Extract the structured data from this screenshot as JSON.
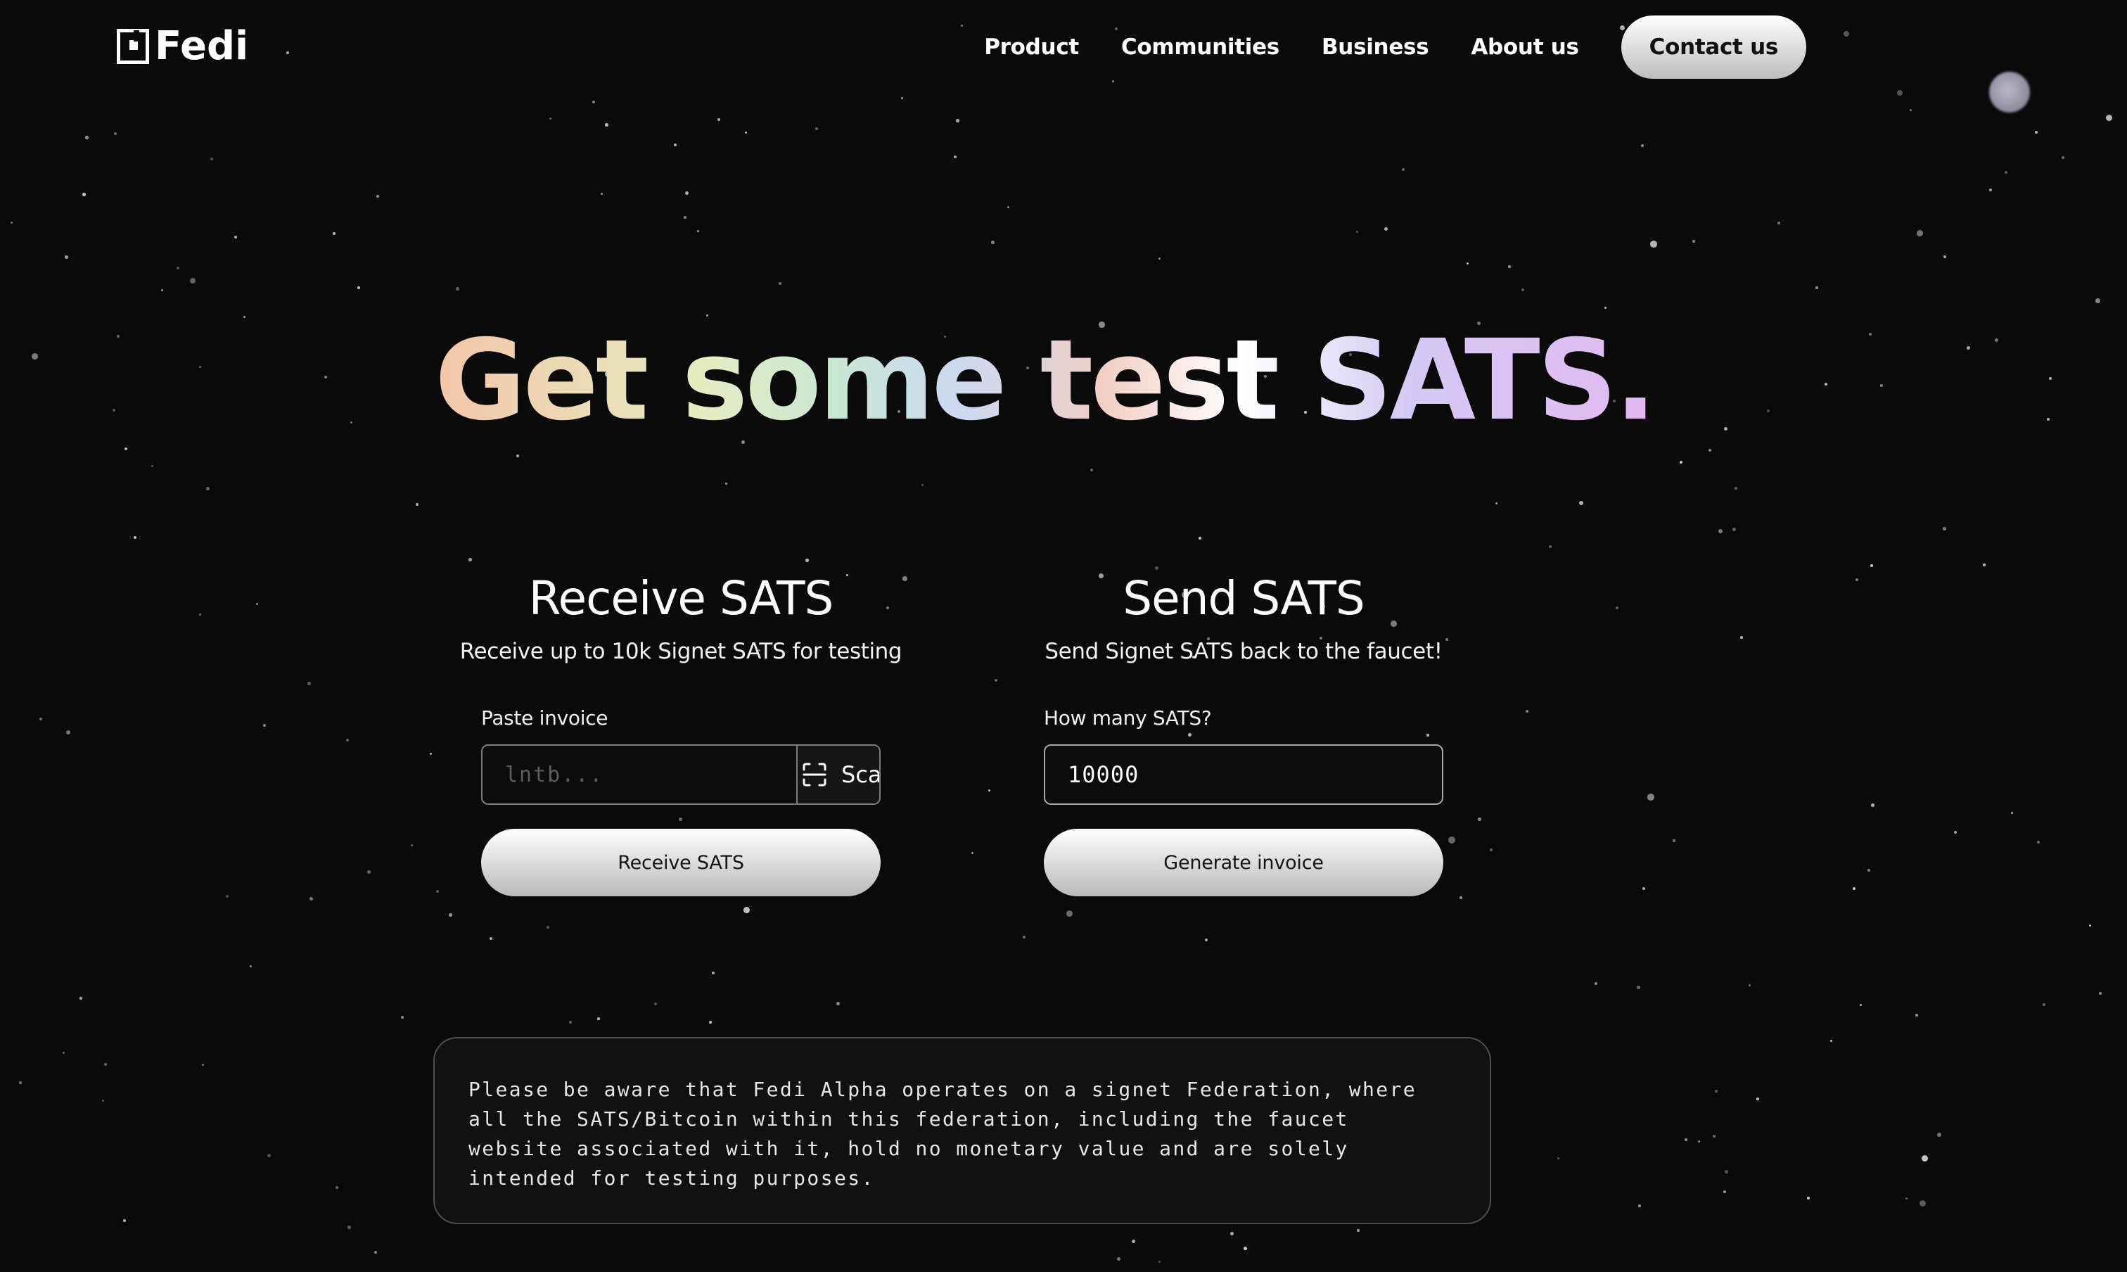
{
  "brand": {
    "name": "Fedi"
  },
  "nav": {
    "links": [
      "Product",
      "Communities",
      "Business",
      "About us"
    ],
    "cta_label": "Contact us"
  },
  "hero": {
    "title": "Get some test SATS."
  },
  "receive": {
    "title": "Receive SATS",
    "subtitle": "Receive up to 10k Signet SATS for testing",
    "field_label": "Paste invoice",
    "placeholder": "lntb...",
    "scan_label": "Scan",
    "button_label": "Receive SATS"
  },
  "send": {
    "title": "Send SATS",
    "subtitle": "Send Signet SATS back to the faucet!",
    "field_label": "How many SATS?",
    "amount_value": "10000",
    "button_label": "Generate invoice"
  },
  "disclaimer": {
    "text": "Please be aware that Fedi Alpha operates on a signet Federation, where all the SATS/Bitcoin within this federation, including the faucet website associated with it, hold no monetary value and are solely intended for testing purposes."
  },
  "colors": {
    "background": "#0a0a0b",
    "button_gradient_top": "#ffffff",
    "button_gradient_bottom": "#b9b9b9",
    "headline_gradient": [
      "#f3c6a8",
      "#e6ecc0",
      "#cbd9f2",
      "#ffffff",
      "#e2b9f0"
    ]
  }
}
